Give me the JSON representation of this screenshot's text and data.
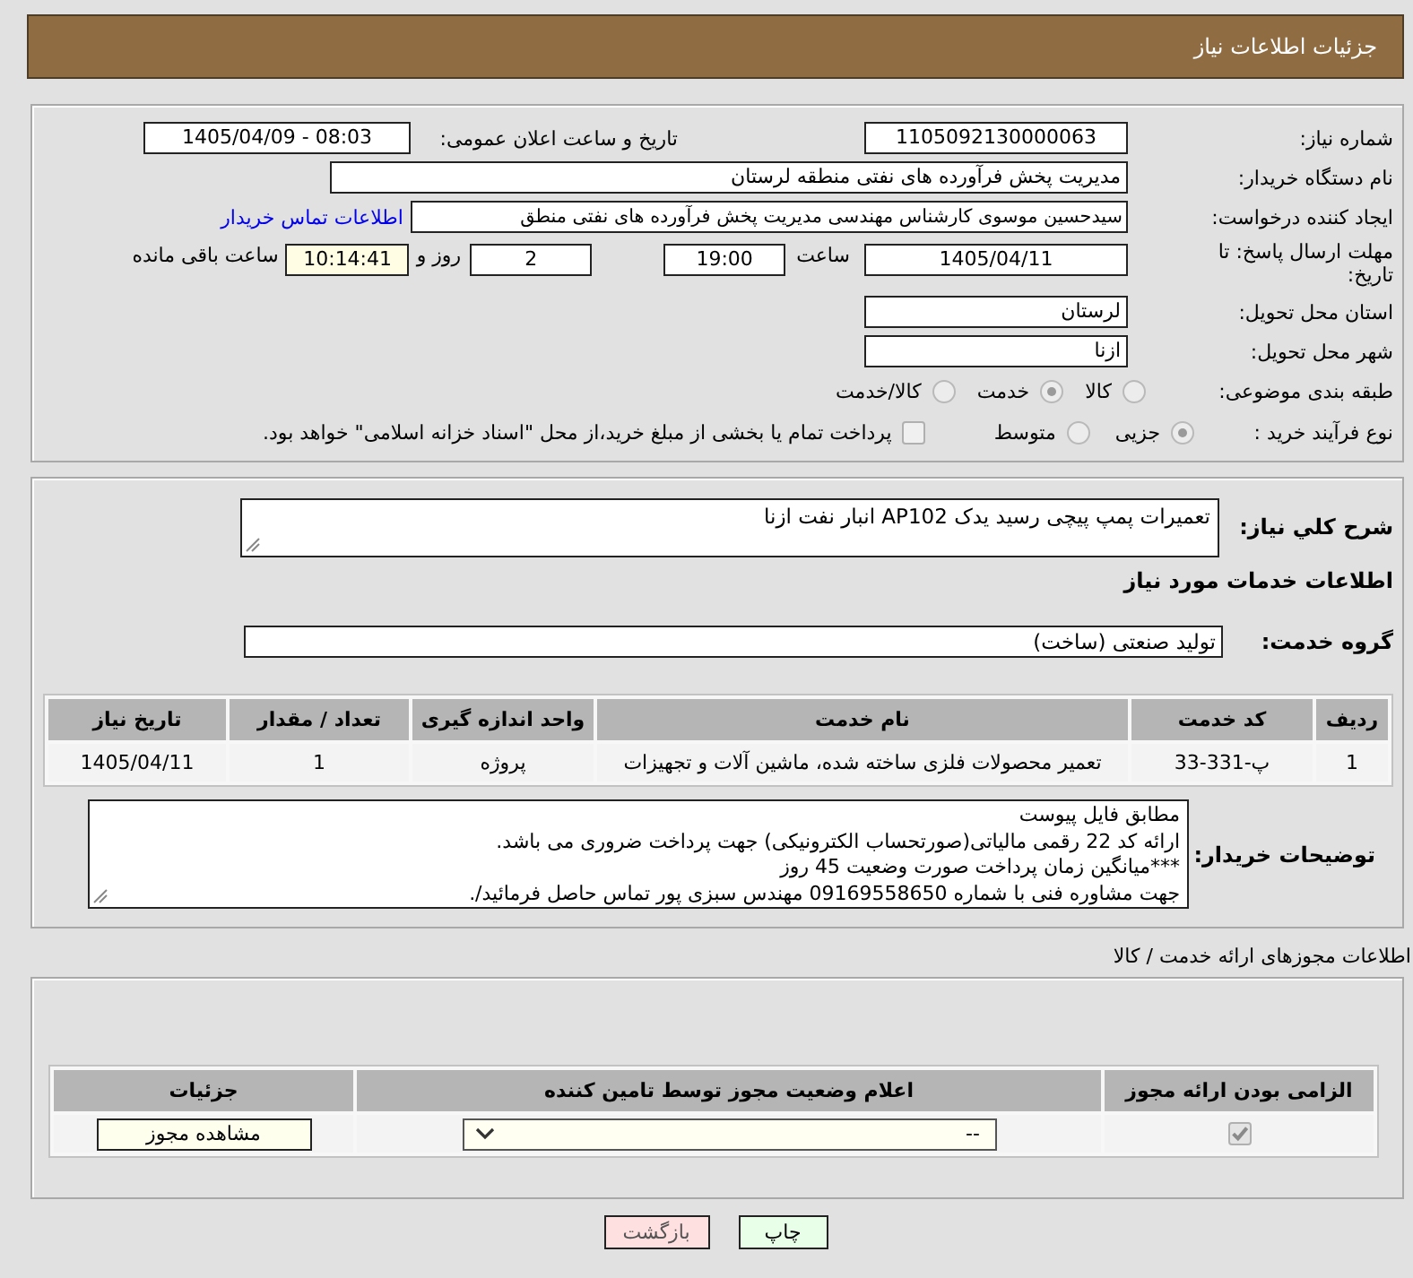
{
  "header": {
    "title": "جزئیات اطلاعات نیاز"
  },
  "need": {
    "number": {
      "label": "شماره نیاز:",
      "value": "1105092130000063"
    },
    "announced": {
      "label": "تاریخ و ساعت اعلان عمومی:",
      "value": "1405/04/09 - 08:03"
    },
    "buyer": {
      "label": "نام دستگاه خریدار:",
      "value": "مدیریت پخش فرآورده های نفتی منطقه لرستان"
    },
    "requester": {
      "label": "ایجاد کننده درخواست:",
      "value": "سیدحسین موسوی کارشناس مهندسی مدیریت پخش فرآورده های نفتی منطق",
      "link": "اطلاعات تماس خریدار"
    },
    "deadline": {
      "label": "مهلت ارسال پاسخ: تا تاریخ:",
      "date": "1405/04/11",
      "time_label": "ساعت",
      "time": "19:00",
      "days": "2",
      "days_label": "روز و",
      "remaining": "10:14:41",
      "remaining_label": "ساعت باقی مانده"
    },
    "province": {
      "label": "استان محل تحویل:",
      "value": "لرستان"
    },
    "city": {
      "label": "شهر محل تحویل:",
      "value": "ازنا"
    },
    "category": {
      "label": "طبقه بندی موضوعی:",
      "options": [
        {
          "label": "کالا",
          "selected": false
        },
        {
          "label": "خدمت",
          "selected": true
        },
        {
          "label": "کالا/خدمت",
          "selected": false
        }
      ]
    },
    "process": {
      "label": "نوع فرآیند خرید :",
      "options": [
        {
          "label": "جزیی",
          "selected": true
        },
        {
          "label": "متوسط",
          "selected": false
        }
      ],
      "treasury": {
        "label": "پرداخت تمام یا بخشی از مبلغ خرید،از محل \"اسناد خزانه اسلامی\" خواهد بود.",
        "checked": false
      }
    }
  },
  "details": {
    "summary": {
      "label": "شرح کلي نياز:",
      "value": "تعمیرات پمپ پیچی رسید یدک AP102 انبار نفت ازنا"
    },
    "services_heading": "اطلاعات خدمات مورد نیاز",
    "service_group": {
      "label": "گروه خدمت:",
      "value": "تولید صنعتی (ساخت)"
    },
    "table": {
      "columns": [
        "ردیف",
        "کد خدمت",
        "نام خدمت",
        "واحد اندازه گیری",
        "تعداد / مقدار",
        "تاریخ نیاز"
      ],
      "rows": [
        [
          "1",
          "پ-331-33",
          "تعمیر محصولات فلزی ساخته شده، ماشین آلات و تجهیزات",
          "پروژه",
          "1",
          "1405/04/11"
        ]
      ]
    },
    "buyer_notes": {
      "label": "توضیحات خریدار:",
      "lines": [
        "مطابق فایل پیوست",
        "ارائه کد 22 رقمی مالیاتی(صورتحساب الکترونیکی) جهت پرداخت ضروری می باشد.",
        "***میانگین زمان پرداخت صورت وضعیت 45 روز",
        "جهت مشاوره فنی با شماره 09169558650 مهندس سبزی پور تماس حاصل فرمائید/."
      ]
    }
  },
  "licenses": {
    "heading": "اطلاعات مجوزهای ارائه خدمت / کالا",
    "columns": [
      "الزامی بودن ارائه مجوز",
      "اعلام وضعیت مجوز توسط تامین کننده",
      "جزئیات"
    ],
    "rows": [
      {
        "checked": true,
        "status": "--",
        "action": "مشاهده مجوز"
      }
    ]
  },
  "buttons": [
    {
      "label": "چاپ",
      "kind": "print"
    },
    {
      "label": "بازگشت",
      "kind": "back"
    }
  ]
}
